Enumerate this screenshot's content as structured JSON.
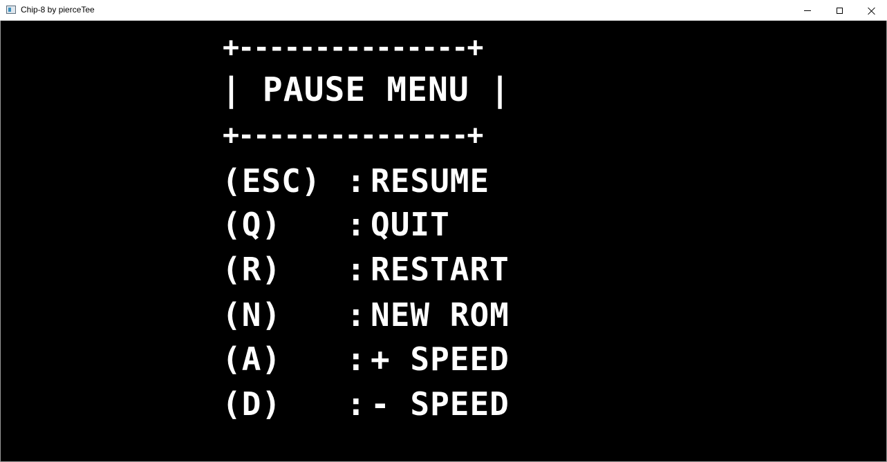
{
  "window": {
    "title": "Chip-8 by pierceTee",
    "controls": {
      "minimize_icon": "minimize-icon",
      "maximize_icon": "maximize-icon",
      "close_icon": "close-icon"
    }
  },
  "menu": {
    "top_border": "+---------------+",
    "title": "| PAUSE MENU |",
    "bottom_border": "+---------------+",
    "items": [
      {
        "key": "(ESC)",
        "sep": ":",
        "action": "RESUME"
      },
      {
        "key": "(Q)",
        "sep": ":",
        "action": "QUIT"
      },
      {
        "key": "(R)",
        "sep": ":",
        "action": "RESTART"
      },
      {
        "key": "(N)",
        "sep": ":",
        "action": "NEW ROM"
      },
      {
        "key": "(A)",
        "sep": ":",
        "action": "+ SPEED"
      },
      {
        "key": "(D)",
        "sep": ":",
        "action": "- SPEED"
      }
    ]
  },
  "colors": {
    "background": "#000000",
    "foreground": "#ffffff",
    "titlebar": "#ffffff"
  }
}
